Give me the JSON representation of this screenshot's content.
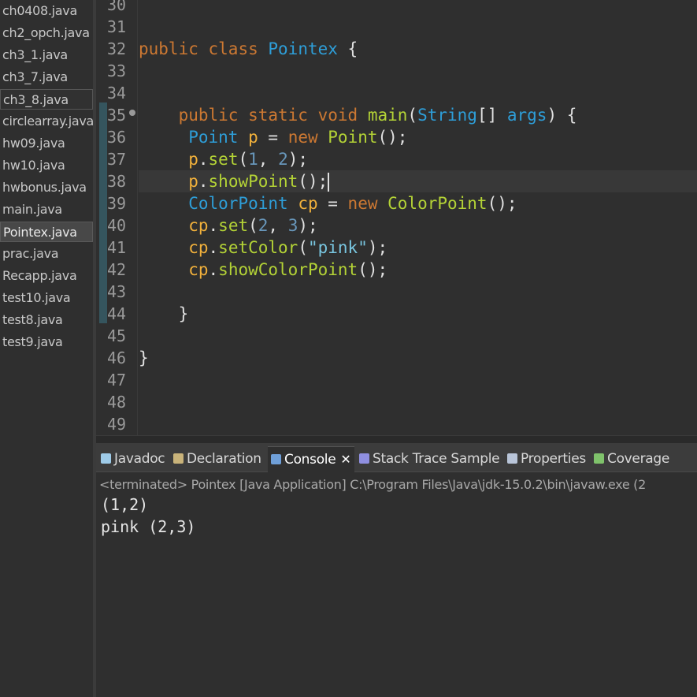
{
  "sidebar": {
    "files": [
      {
        "name": "ch0408.java",
        "state": "normal"
      },
      {
        "name": "ch2_opch.java",
        "state": "normal"
      },
      {
        "name": "ch3_1.java",
        "state": "normal"
      },
      {
        "name": "ch3_7.java",
        "state": "normal"
      },
      {
        "name": "ch3_8.java",
        "state": "outlined"
      },
      {
        "name": "circlearray.java",
        "state": "normal"
      },
      {
        "name": "hw09.java",
        "state": "normal"
      },
      {
        "name": "hw10.java",
        "state": "normal"
      },
      {
        "name": "hwbonus.java",
        "state": "normal"
      },
      {
        "name": "main.java",
        "state": "normal"
      },
      {
        "name": "Pointex.java",
        "state": "selected"
      },
      {
        "name": "prac.java",
        "state": "normal"
      },
      {
        "name": "Recapp.java",
        "state": "normal"
      },
      {
        "name": "test10.java",
        "state": "normal"
      },
      {
        "name": "test8.java",
        "state": "normal"
      },
      {
        "name": "test9.java",
        "state": "normal"
      }
    ]
  },
  "editor": {
    "line_numbers": [
      "30",
      "31",
      "32",
      "33",
      "34",
      "35",
      "36",
      "37",
      "38",
      "39",
      "40",
      "41",
      "42",
      "43",
      "44",
      "45",
      "46",
      "47",
      "48",
      "49"
    ],
    "current_line": "38",
    "lines": [
      [],
      [],
      [
        {
          "t": "public",
          "c": "kw"
        },
        {
          "t": " ",
          "c": "punc"
        },
        {
          "t": "class",
          "c": "kw"
        },
        {
          "t": " ",
          "c": "punc"
        },
        {
          "t": "Pointex",
          "c": "ty"
        },
        {
          "t": " {",
          "c": "punc"
        }
      ],
      [],
      [],
      [
        {
          "t": "    ",
          "c": "punc"
        },
        {
          "t": "public",
          "c": "kw"
        },
        {
          "t": " ",
          "c": "punc"
        },
        {
          "t": "static",
          "c": "kw"
        },
        {
          "t": " ",
          "c": "punc"
        },
        {
          "t": "void",
          "c": "kw"
        },
        {
          "t": " ",
          "c": "punc"
        },
        {
          "t": "main",
          "c": "fn"
        },
        {
          "t": "(",
          "c": "punc"
        },
        {
          "t": "String",
          "c": "ty"
        },
        {
          "t": "[] ",
          "c": "punc"
        },
        {
          "t": "args",
          "c": "ty"
        },
        {
          "t": ") {",
          "c": "punc"
        }
      ],
      [
        {
          "t": "     ",
          "c": "punc"
        },
        {
          "t": "Point",
          "c": "ty"
        },
        {
          "t": " ",
          "c": "punc"
        },
        {
          "t": "p",
          "c": "var"
        },
        {
          "t": " = ",
          "c": "punc"
        },
        {
          "t": "new",
          "c": "kw"
        },
        {
          "t": " ",
          "c": "punc"
        },
        {
          "t": "Point",
          "c": "fn"
        },
        {
          "t": "();",
          "c": "punc"
        }
      ],
      [
        {
          "t": "     ",
          "c": "punc"
        },
        {
          "t": "p",
          "c": "var"
        },
        {
          "t": ".",
          "c": "punc"
        },
        {
          "t": "set",
          "c": "fn"
        },
        {
          "t": "(",
          "c": "punc"
        },
        {
          "t": "1",
          "c": "num"
        },
        {
          "t": ", ",
          "c": "punc"
        },
        {
          "t": "2",
          "c": "num"
        },
        {
          "t": ");",
          "c": "punc"
        }
      ],
      [
        {
          "t": "     ",
          "c": "punc"
        },
        {
          "t": "p",
          "c": "var"
        },
        {
          "t": ".",
          "c": "punc"
        },
        {
          "t": "showPoint",
          "c": "fn"
        },
        {
          "t": "();",
          "c": "punc"
        }
      ],
      [
        {
          "t": "     ",
          "c": "punc"
        },
        {
          "t": "ColorPoint",
          "c": "ty"
        },
        {
          "t": " ",
          "c": "punc"
        },
        {
          "t": "cp",
          "c": "var"
        },
        {
          "t": " = ",
          "c": "punc"
        },
        {
          "t": "new",
          "c": "kw"
        },
        {
          "t": " ",
          "c": "punc"
        },
        {
          "t": "ColorPoint",
          "c": "fn"
        },
        {
          "t": "();",
          "c": "punc"
        }
      ],
      [
        {
          "t": "     ",
          "c": "punc"
        },
        {
          "t": "cp",
          "c": "var"
        },
        {
          "t": ".",
          "c": "punc"
        },
        {
          "t": "set",
          "c": "fn"
        },
        {
          "t": "(",
          "c": "punc"
        },
        {
          "t": "2",
          "c": "num"
        },
        {
          "t": ", ",
          "c": "punc"
        },
        {
          "t": "3",
          "c": "num"
        },
        {
          "t": ");",
          "c": "punc"
        }
      ],
      [
        {
          "t": "     ",
          "c": "punc"
        },
        {
          "t": "cp",
          "c": "var"
        },
        {
          "t": ".",
          "c": "punc"
        },
        {
          "t": "setColor",
          "c": "fn"
        },
        {
          "t": "(",
          "c": "punc"
        },
        {
          "t": "\"pink\"",
          "c": "str"
        },
        {
          "t": ");",
          "c": "punc"
        }
      ],
      [
        {
          "t": "     ",
          "c": "punc"
        },
        {
          "t": "cp",
          "c": "var"
        },
        {
          "t": ".",
          "c": "punc"
        },
        {
          "t": "showColorPoint",
          "c": "fn"
        },
        {
          "t": "();",
          "c": "punc"
        }
      ],
      [],
      [
        {
          "t": "    }",
          "c": "punc"
        }
      ],
      [],
      [
        {
          "t": "}",
          "c": "punc"
        }
      ],
      [],
      [],
      []
    ]
  },
  "panel": {
    "tabs": [
      {
        "label": "Javadoc",
        "icon": "javadoc-icon",
        "color": "#9ecbe8",
        "active": false
      },
      {
        "label": "Declaration",
        "icon": "declaration-icon",
        "color": "#c9b37a",
        "active": false
      },
      {
        "label": "Console",
        "icon": "console-icon",
        "color": "#6f9fd8",
        "active": true,
        "close": "✕"
      },
      {
        "label": "Stack Trace Sample",
        "icon": "stack-trace-icon",
        "color": "#8f8fe0",
        "active": false
      },
      {
        "label": "Properties",
        "icon": "properties-icon",
        "color": "#b8c4d8",
        "active": false
      },
      {
        "label": "Coverage",
        "icon": "coverage-icon",
        "color": "#7fc26b",
        "active": false
      }
    ],
    "status": "<terminated> Pointex [Java Application] C:\\Program Files\\Java\\jdk-15.0.2\\bin\\javaw.exe (2",
    "output": [
      "(1,2)",
      "pink (2,3)"
    ]
  }
}
